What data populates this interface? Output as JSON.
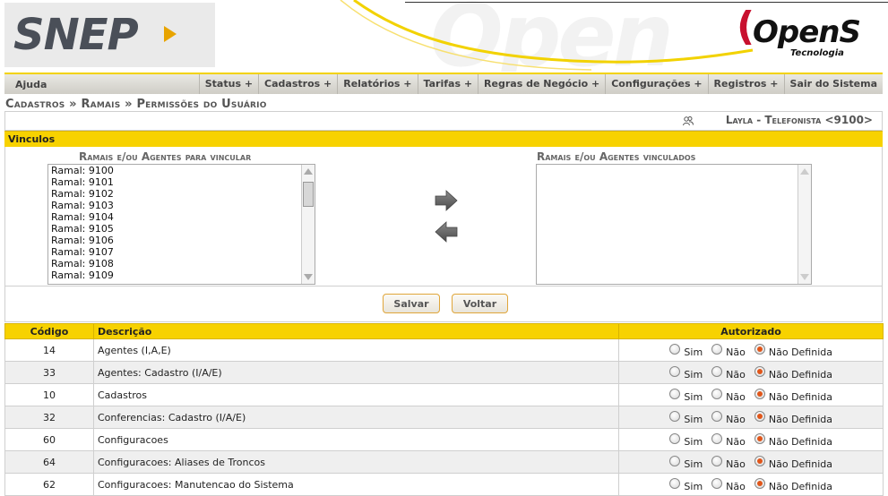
{
  "header": {
    "logo_text": "SNEP",
    "brand": {
      "name": "OpenS",
      "tagline": "Tecnologia"
    },
    "colors": {
      "accent": "#f7d200",
      "brand_red": "#c8102e",
      "radio_on": "#e0561a"
    }
  },
  "menubar": {
    "help": "Ajuda",
    "items": [
      "Status +",
      "Cadastros +",
      "Relatórios +",
      "Tarifas +",
      "Regras de Negócio +",
      "Configurações +",
      "Registros +",
      "Sair do Sistema"
    ]
  },
  "breadcrumb": "Cadastros » Ramais » Permissões do Usuário",
  "user": {
    "icon": "users-icon",
    "label": "Layla - Telefonista <9100>"
  },
  "vinculos": {
    "title": "Vinculos",
    "available_label": "Ramais e/ou Agentes para vincular",
    "linked_label": "Ramais e/ou Agentes vinculados",
    "available_options": [
      "Ramal: 9100",
      "Ramal: 9101",
      "Ramal: 9102",
      "Ramal: 9103",
      "Ramal: 9104",
      "Ramal: 9105",
      "Ramal: 9106",
      "Ramal: 9107",
      "Ramal: 9108",
      "Ramal: 9109"
    ],
    "linked_options": [],
    "add_icon": "arrow-right-icon",
    "remove_icon": "arrow-left-icon"
  },
  "buttons": {
    "save": "Salvar",
    "back": "Voltar"
  },
  "table": {
    "headers": {
      "code": "Código",
      "description": "Descrição",
      "authorized": "Autorizado"
    },
    "radio_labels": {
      "yes": "Sim",
      "no": "Não",
      "undefined": "Não Definida"
    },
    "rows": [
      {
        "code": "14",
        "description": "Agentes (I,A,E)",
        "selected": "undefined"
      },
      {
        "code": "33",
        "description": "Agentes: Cadastro (I/A/E)",
        "selected": "undefined"
      },
      {
        "code": "10",
        "description": "Cadastros",
        "selected": "undefined"
      },
      {
        "code": "32",
        "description": "Conferencias: Cadastro (I/A/E)",
        "selected": "undefined"
      },
      {
        "code": "60",
        "description": "Configuracoes",
        "selected": "undefined"
      },
      {
        "code": "64",
        "description": "Configuracoes: Aliases de Troncos",
        "selected": "undefined"
      },
      {
        "code": "62",
        "description": "Configuracoes: Manutencao do Sistema",
        "selected": "undefined"
      }
    ]
  }
}
